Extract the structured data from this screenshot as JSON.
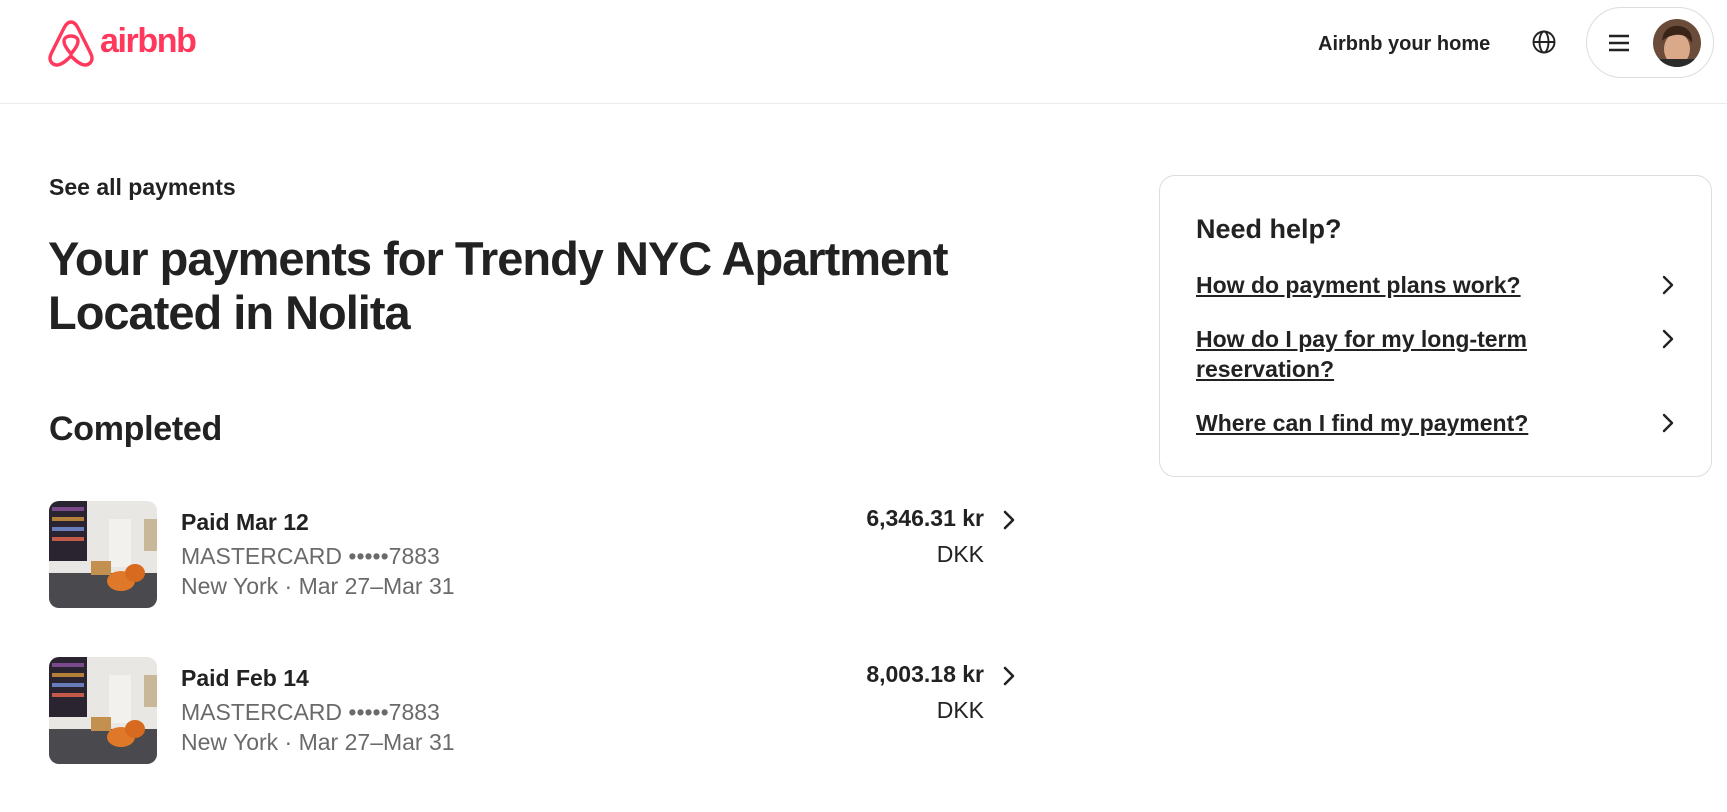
{
  "header": {
    "logo_text": "airbnb",
    "host_link": "Airbnb your home",
    "brand_color": "#FF385C",
    "icons": [
      "airbnb-logo-icon",
      "globe-icon",
      "hamburger-menu-icon",
      "avatar"
    ]
  },
  "main": {
    "back_link": "See all payments",
    "title": "Your payments for Trendy NYC Apartment Located in Nolita",
    "section_title": "Completed",
    "payments": [
      {
        "title": "Paid Mar 12",
        "card": "MASTERCARD •••••7883",
        "location": "New York · Mar 27–Mar 31",
        "amount": "6,346.31 kr",
        "currency": "DKK"
      },
      {
        "title": "Paid Feb 14",
        "card": "MASTERCARD •••••7883",
        "location": "New York · Mar 27–Mar 31",
        "amount": "8,003.18 kr",
        "currency": "DKK"
      }
    ]
  },
  "help": {
    "title": "Need help?",
    "links": [
      "How do payment plans work?",
      "How do I pay for my long-term reservation?",
      "Where can I find my payment?"
    ]
  }
}
